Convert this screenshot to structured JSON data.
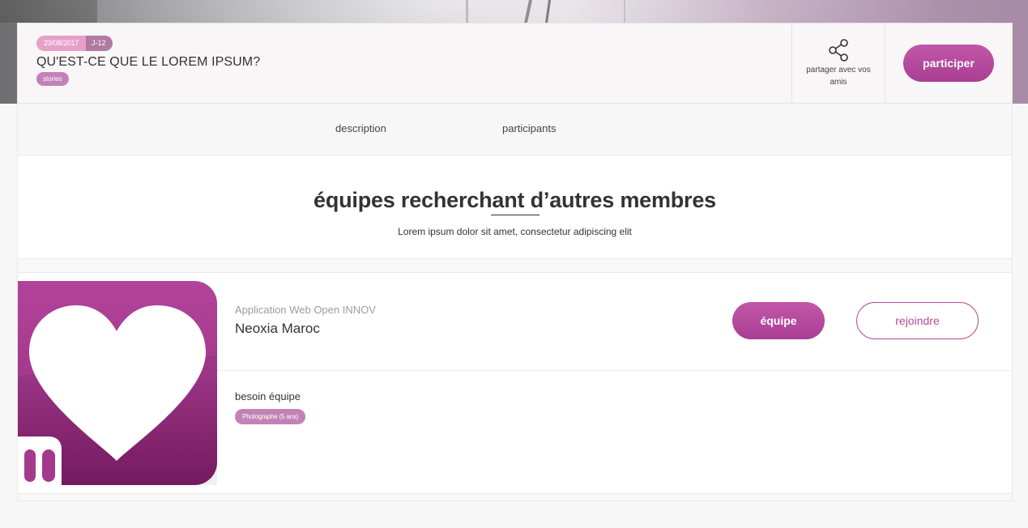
{
  "event": {
    "date": "23/08/2017",
    "countdown": "J-12",
    "title": "QU'EST-CE QUE LE LOREM IPSUM?",
    "category": "stories",
    "share_label": "partager avec vos amis",
    "participate_label": "participer"
  },
  "tabs": [
    {
      "label": "description"
    },
    {
      "label": "participants"
    }
  ],
  "section": {
    "title": "équipes recherchant d’autres membres",
    "subtitle": "Lorem ipsum dolor sit amet, consectetur adipiscing elit"
  },
  "team": {
    "project": "Application Web Open INNOV",
    "name": "Neoxia Maroc",
    "team_button": "équipe",
    "join_button": "rejoindre",
    "need_label": "besoin équipe",
    "roles": [
      "Photographe (5 ans)"
    ]
  },
  "colors": {
    "accent": "#b64a9d",
    "badge_pink": "#e7a0c8",
    "badge_mauve": "#c282b6"
  },
  "icons": {
    "share": "share-icon",
    "logo": "heart-logo"
  }
}
